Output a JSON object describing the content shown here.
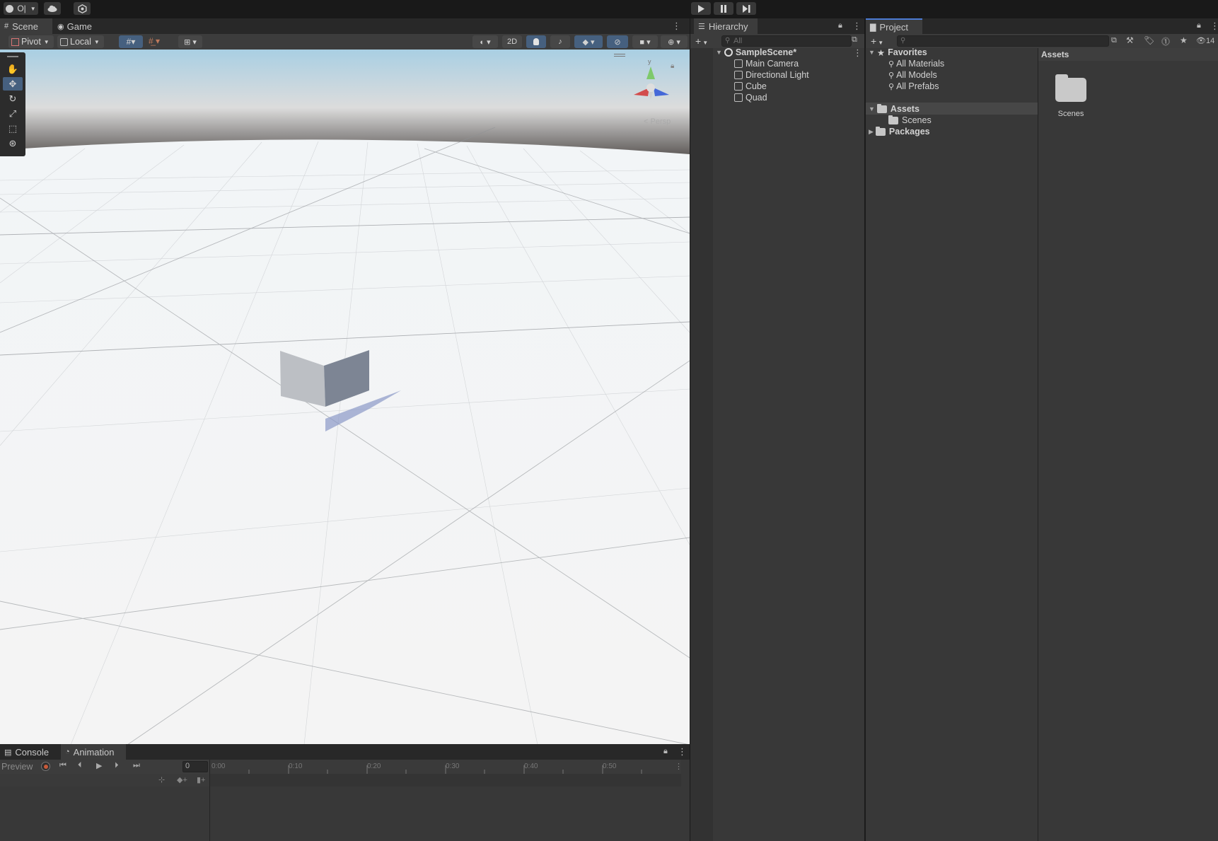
{
  "topbar": {
    "account_label": "O|",
    "cloud_icon": "cloud-icon",
    "collab_icon": "services-icon",
    "play_icon": "play-icon",
    "pause_icon": "pause-icon",
    "step_icon": "step-icon"
  },
  "scene_tabs": {
    "scene": "Scene",
    "game": "Game"
  },
  "scene_toolbar": {
    "pivot": "Pivot",
    "local": "Local",
    "mode_2d": "2D"
  },
  "gizmo": {
    "y_label": "y",
    "persp_label": "Persp"
  },
  "hierarchy": {
    "title": "Hierarchy",
    "search_placeholder": "All",
    "scene_name": "SampleScene*",
    "items": [
      {
        "label": "Main Camera"
      },
      {
        "label": "Directional Light"
      },
      {
        "label": "Cube"
      },
      {
        "label": "Quad"
      }
    ]
  },
  "project": {
    "title": "Project",
    "hidden_count": "14",
    "favorites_label": "Favorites",
    "favorites": [
      {
        "label": "All Materials"
      },
      {
        "label": "All Models"
      },
      {
        "label": "All Prefabs"
      }
    ],
    "assets_label": "Assets",
    "scenes_label": "Scenes",
    "packages_label": "Packages",
    "breadcrumb": "Assets",
    "grid_items": [
      {
        "label": "Scenes"
      }
    ]
  },
  "bottom": {
    "console_tab": "Console",
    "animation_tab": "Animation",
    "preview": "Preview",
    "frame_value": "0",
    "timeline_ticks": [
      "0:00",
      "0:10",
      "0:20",
      "0:30",
      "0:40",
      "0:50"
    ]
  },
  "colors": {
    "accent": "#4c7bd4",
    "panel": "#383838",
    "background": "#191919"
  }
}
